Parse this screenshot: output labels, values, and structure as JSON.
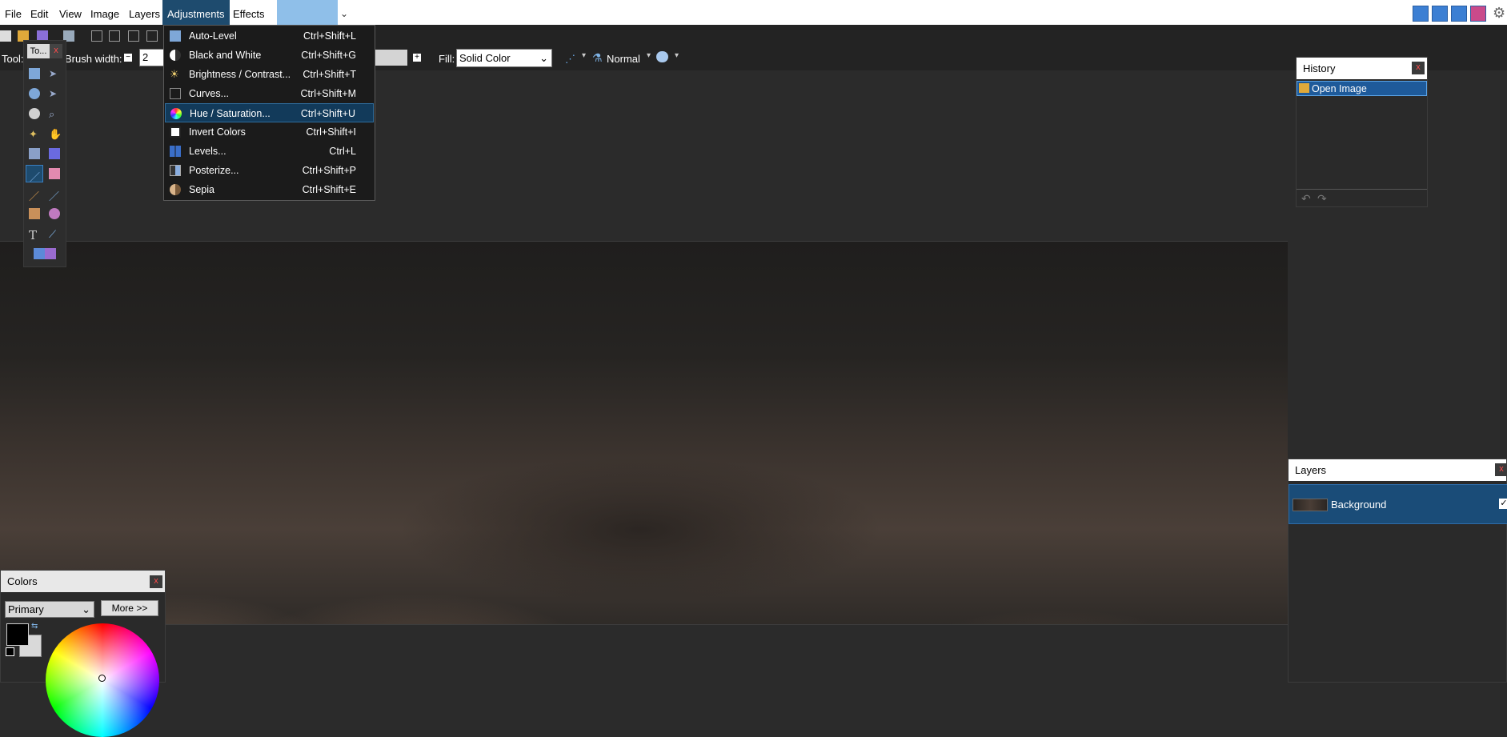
{
  "menubar": {
    "items": [
      "File",
      "Edit",
      "View",
      "Image",
      "Layers",
      "Adjustments",
      "Effects"
    ],
    "active": "Adjustments"
  },
  "toolbar": {
    "tool_label": "Tool:",
    "brush_width_label": "Brush width:",
    "brush_width_value": "2",
    "fill_label": "Fill:",
    "fill_value": "Solid Color",
    "blend_mode": "Normal"
  },
  "tools_panel": {
    "title": "To...",
    "close": "x"
  },
  "adjustments_menu": {
    "items": [
      {
        "label": "Auto-Level",
        "shortcut": "Ctrl+Shift+L",
        "icon": "auto-level-icon"
      },
      {
        "label": "Black and White",
        "shortcut": "Ctrl+Shift+G",
        "icon": "black-white-icon"
      },
      {
        "label": "Brightness / Contrast...",
        "shortcut": "Ctrl+Shift+T",
        "icon": "brightness-icon"
      },
      {
        "label": "Curves...",
        "shortcut": "Ctrl+Shift+M",
        "icon": "curves-icon"
      },
      {
        "label": "Hue / Saturation...",
        "shortcut": "Ctrl+Shift+U",
        "icon": "hue-saturation-icon",
        "highlighted": true
      },
      {
        "label": "Invert Colors",
        "shortcut": "Ctrl+Shift+I",
        "icon": "invert-icon"
      },
      {
        "label": "Levels...",
        "shortcut": "Ctrl+L",
        "icon": "levels-icon"
      },
      {
        "label": "Posterize...",
        "shortcut": "Ctrl+Shift+P",
        "icon": "posterize-icon"
      },
      {
        "label": "Sepia",
        "shortcut": "Ctrl+Shift+E",
        "icon": "sepia-icon"
      }
    ]
  },
  "history": {
    "title": "History",
    "close": "x",
    "items": [
      "Open Image"
    ]
  },
  "layers": {
    "title": "Layers",
    "close": "x",
    "items": [
      {
        "name": "Background",
        "visible": true
      }
    ]
  },
  "colors": {
    "title": "Colors",
    "close": "x",
    "mode_value": "Primary",
    "more_label": "More >>",
    "primary_color": "#000000",
    "secondary_color": "#d9d9d9"
  }
}
